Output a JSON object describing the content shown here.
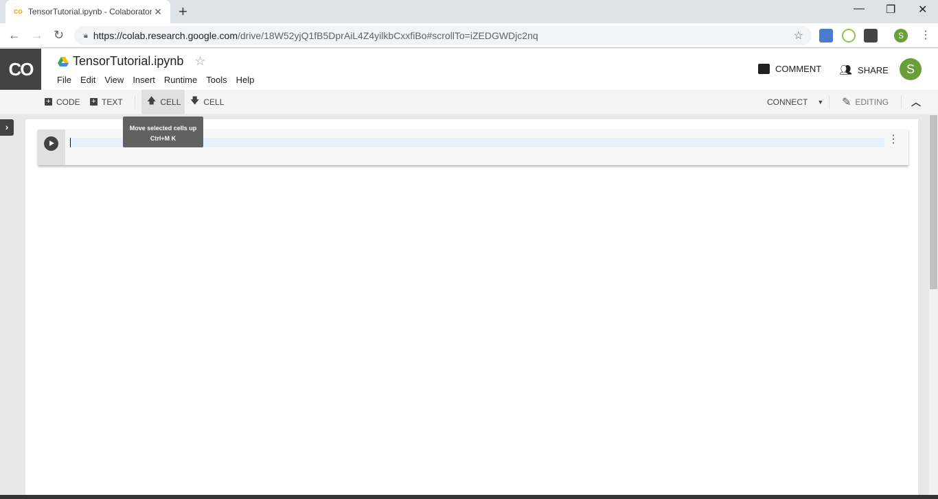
{
  "browser": {
    "tab_title": "TensorTutorial.ipynb - Colaboratory",
    "url_host": "https://colab.research.google.com",
    "url_path": "/drive/18W52yjQ1fB5DprAiL4Z4yilkbCxxfiBo#scrollTo=iZEDGWDjc2nq",
    "profile_initial": "S"
  },
  "app": {
    "logo": "CO",
    "notebook_title": "TensorTutorial.ipynb",
    "menu": [
      "File",
      "Edit",
      "View",
      "Insert",
      "Runtime",
      "Tools",
      "Help"
    ],
    "comment": "COMMENT",
    "share": "SHARE",
    "user_initial": "S"
  },
  "toolbar": {
    "code": "CODE",
    "text": "TEXT",
    "cell_up": "CELL",
    "cell_down": "CELL",
    "connect": "CONNECT",
    "editing": "EDITING"
  },
  "tooltip": {
    "line1": "Move selected cells up",
    "line2": "Ctrl+M K"
  },
  "colors": {
    "accent": "#689f38",
    "logo_bg": "#424242"
  }
}
